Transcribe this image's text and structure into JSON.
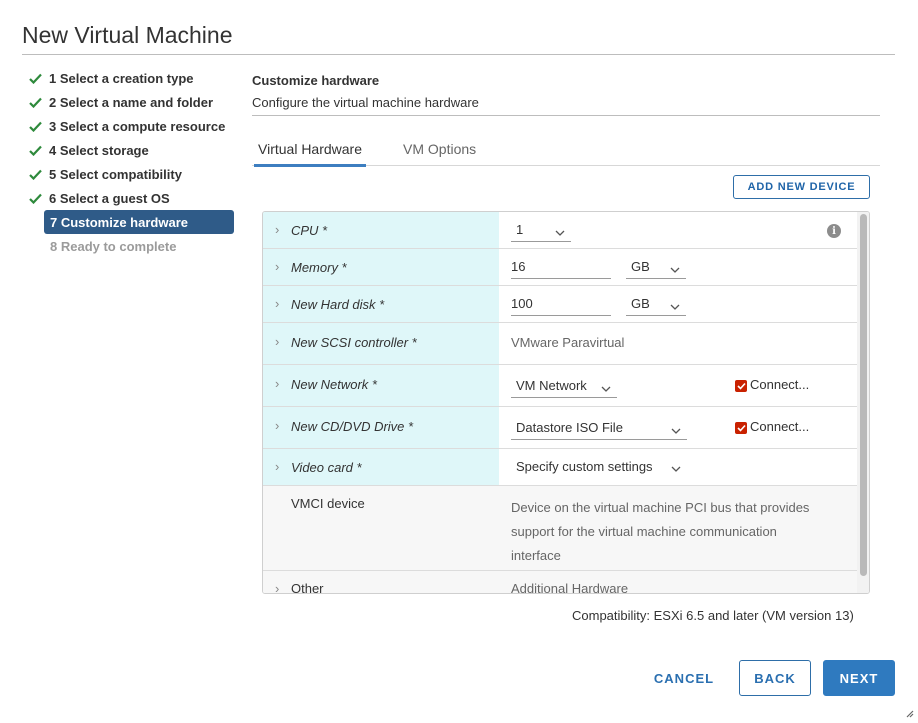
{
  "dialog": {
    "title": "New Virtual Machine"
  },
  "steps": [
    {
      "label": "1 Select a creation type",
      "state": "done"
    },
    {
      "label": "2 Select a name and folder",
      "state": "done"
    },
    {
      "label": "3 Select a compute resource",
      "state": "done"
    },
    {
      "label": "4 Select storage",
      "state": "done"
    },
    {
      "label": "5 Select compatibility",
      "state": "done"
    },
    {
      "label": "6 Select a guest OS",
      "state": "done"
    },
    {
      "label": "7 Customize hardware",
      "state": "active"
    },
    {
      "label": "8 Ready to complete",
      "state": "future"
    }
  ],
  "section": {
    "title": "Customize hardware",
    "subtitle": "Configure the virtual machine hardware"
  },
  "tabs": [
    {
      "label": "Virtual Hardware",
      "active": true
    },
    {
      "label": "VM Options",
      "active": false
    }
  ],
  "add_device_label": "ADD NEW DEVICE",
  "hardware": {
    "cpu": {
      "label": "CPU *",
      "value": "1"
    },
    "memory": {
      "label": "Memory *",
      "value": "16",
      "unit": "GB"
    },
    "hard_disk": {
      "label": "New Hard disk *",
      "value": "100",
      "unit": "GB"
    },
    "scsi": {
      "label": "New SCSI controller *",
      "value": "VMware Paravirtual"
    },
    "network": {
      "label": "New Network *",
      "value": "VM Network",
      "connect_label": "Connect..."
    },
    "cd_dvd": {
      "label": "New CD/DVD Drive *",
      "value": "Datastore ISO File",
      "connect_label": "Connect..."
    },
    "video": {
      "label": "Video card *",
      "value": "Specify custom settings"
    },
    "vmci": {
      "label": "VMCI device",
      "line1": "Device on the virtual machine PCI bus that provides",
      "line2": "support for the virtual machine communication",
      "line3": "interface"
    },
    "other": {
      "label": "Other",
      "value": "Additional Hardware"
    }
  },
  "compatibility": "Compatibility: ESXi 6.5 and later (VM version 13)",
  "buttons": {
    "cancel": "CANCEL",
    "back": "BACK",
    "next": "NEXT"
  },
  "colors": {
    "accent": "#2f7abf",
    "active_step": "#2f5b88",
    "check_green": "#2e8a3c",
    "row_highlight": "#dff7f9",
    "checkbox_red": "#c92100"
  }
}
